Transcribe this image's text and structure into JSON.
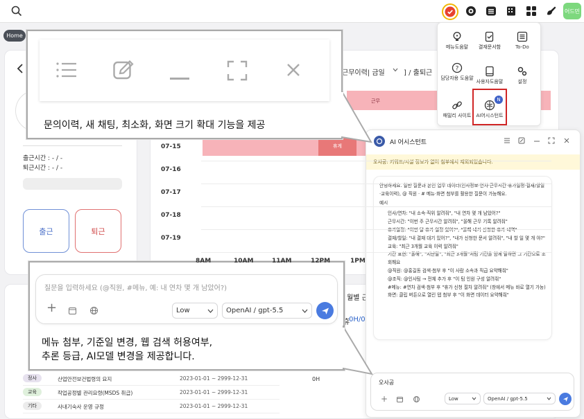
{
  "topbar": {
    "avatar_label": "어드민",
    "notification_color": "#e8432f"
  },
  "breadcrumb": {
    "home": "Home"
  },
  "attendance": {
    "clock_in_text": "출근시간 : - / -",
    "clock_out_text": "퇴근시간 : - / -",
    "clock_in_button": "출근",
    "clock_out_button": "퇴근",
    "filter_text": "근무이력| 금일",
    "filter_suffix": "] / 출퇴근",
    "timeline_dates": [
      "07-15",
      "07-16",
      "07-17",
      "07-18",
      "07-19"
    ],
    "time_axis": [
      "8AM",
      "10AM",
      "11AM",
      "12PM",
      "1PM"
    ],
    "bar_work_label": "근무",
    "bar_leave_label": "휴게"
  },
  "bottom": {
    "month_label": "월별 근",
    "leave_prefix": "휴",
    "hours_value": "0H/0",
    "zero_h": "0H",
    "rows": [
      {
        "tag": "정사",
        "tag_color": "#e7e2ef",
        "title": "산업안전보건법령의 요지",
        "period": "2023-01-01 ~ 2999-12-31"
      },
      {
        "tag": "교육",
        "tag_color": "#dff0dc",
        "title": "작업공정별 관리요령(MSDS 취급)",
        "period": "2023-01-01 ~ 2999-12-31"
      },
      {
        "tag": "기타",
        "tag_color": "#ececec",
        "title": "사내기숙사 운영 규정",
        "period": "2023-01-01 ~ 2999-12-31"
      }
    ]
  },
  "menu": {
    "items": [
      {
        "label": "메뉴도움말",
        "icon": "bulb-icon"
      },
      {
        "label": "결재문서함",
        "icon": "doc-check-icon"
      },
      {
        "label": "To-Do",
        "icon": "list-icon"
      },
      {
        "label": "담당자용 도움말",
        "icon": "help-circle-icon"
      },
      {
        "label": "사용자도움말",
        "icon": "book-icon"
      },
      {
        "label": "설정",
        "icon": "gears-icon"
      },
      {
        "label": "패밀리 사이트",
        "icon": "link-icon"
      },
      {
        "label": "AI어시스턴트",
        "icon": "brain-icon"
      }
    ],
    "new_badge": "N",
    "highlight_color": "#d02525"
  },
  "ai": {
    "title": "AI 어시스턴트",
    "warning": "오사공: 키워드/시설 정보가 없어 첨부에서 제외되었습니다.",
    "intro": "안녕하세요. 일반 질문과 본인 업무 데이터(인사정보·연차·근무시간·휴가일정·결재/할일·교육이력), @ 직원 · # 메뉴·화면 첨부를 활용한 질문이 가능해요.",
    "examples_title": "예시",
    "examples": [
      "인사/연차: \"내 소속·직위 알려줘\", \"내 연차 몇 개 남았어?\"",
      "근무시간: \"이번 주 근무시간 알려줘\", \"올해 근무 기록 알려줘\"",
      "휴가일정: \"이번 달 휴가 일정 있어?\", \"올해 내가 신청한 휴가 내역\"",
      "결재/할일: \"내 결재 대기 있어?\", \"내가 신청한 문서 알려줘\", \"내 할 일 몇 개 야?\"",
      "교육: \"최근 3개월 교육 이력 알려줘\"",
      "기간 표현: \"올해\", \"지난달\", \"최근 3개월\"처럼 기간을 함께 말하면 그 기간으로 조회해요",
      "@직원: @홍길동 검색·첨부 후 \"이 사람 소속과 직급 요약해줘\"",
      "@조직: @인사팀 → 전체 추가 후 \"이 팀 인원 구성 알려줘\"",
      "#메뉴: #연차 검색·첨부 후 \"휴가 신청 절차 알려줘\" (창에서 메뉴 바로 열기 가능)",
      "화면: 클립 버튼으로 열린 탭 첨부 후 \"이 화면 데이터 요약해줘\""
    ],
    "input_value": "오사공",
    "reasoning": "Low",
    "model": "OpenAI / gpt-5.5"
  },
  "callout1": {
    "text": "문의이력, 새 채팅, 최소화, 화면 크기 확대 기능을 제공"
  },
  "callout2": {
    "placeholder": "질문을 입력하세요 (@직원, #메뉴, 예: 내 연차 몇 개 남았어?)",
    "reasoning": "Low",
    "model": "OpenAI / gpt-5.5",
    "text_line1": "메뉴 첨부, 기준일 변경, 웹 검색 허용여부,",
    "text_line2": "추론 등급, AI모델 변경을 제공합니다."
  }
}
